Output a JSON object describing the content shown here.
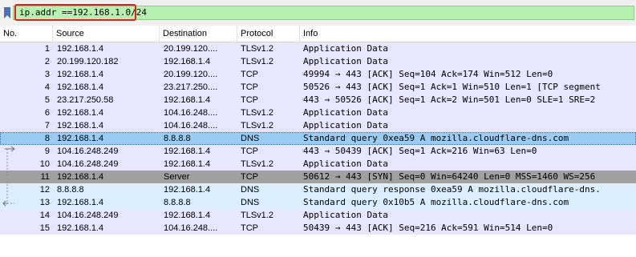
{
  "filter": {
    "text": "ip.addr ==192.168.1.0/24",
    "bookmark_icon": "bookmark-icon",
    "background": "#b7f1b1",
    "highlight_color": "#e0201b"
  },
  "columns": {
    "no": "No.",
    "source": "Source",
    "destination": "Destination",
    "protocol": "Protocol",
    "info": "Info"
  },
  "colors": {
    "tcp": "#e7e6ff",
    "udp": "#daeeff",
    "selected": "#99cbf3",
    "syn": "#a0a0a0"
  },
  "packets": [
    {
      "no": "1",
      "source": "192.168.1.4",
      "destination": "20.199.120....",
      "protocol": "TLSv1.2",
      "info": "Application Data",
      "bg": "tcp"
    },
    {
      "no": "2",
      "source": "20.199.120.182",
      "destination": "192.168.1.4",
      "protocol": "TLSv1.2",
      "info": "Application Data",
      "bg": "tcp"
    },
    {
      "no": "3",
      "source": "192.168.1.4",
      "destination": "20.199.120....",
      "protocol": "TCP",
      "info": "49994 → 443 [ACK] Seq=104 Ack=174 Win=512 Len=0",
      "bg": "tcp"
    },
    {
      "no": "4",
      "source": "192.168.1.4",
      "destination": "23.217.250....",
      "protocol": "TCP",
      "info": "50526 → 443 [ACK] Seq=1 Ack=1 Win=510 Len=1 [TCP segment",
      "bg": "tcp"
    },
    {
      "no": "5",
      "source": "23.217.250.58",
      "destination": "192.168.1.4",
      "protocol": "TCP",
      "info": "443 → 50526 [ACK] Seq=1 Ack=2 Win=501 Len=0 SLE=1 SRE=2",
      "bg": "tcp"
    },
    {
      "no": "6",
      "source": "192.168.1.4",
      "destination": "104.16.248....",
      "protocol": "TLSv1.2",
      "info": "Application Data",
      "bg": "tcp"
    },
    {
      "no": "7",
      "source": "192.168.1.4",
      "destination": "104.16.248....",
      "protocol": "TLSv1.2",
      "info": "Application Data",
      "bg": "tcp"
    },
    {
      "no": "8",
      "source": "192.168.1.4",
      "destination": "8.8.8.8",
      "protocol": "DNS",
      "info": "Standard query 0xea59 A mozilla.cloudflare-dns.com",
      "bg": "selected"
    },
    {
      "no": "9",
      "source": "104.16.248.249",
      "destination": "192.168.1.4",
      "protocol": "TCP",
      "info": "443 → 50439 [ACK] Seq=1 Ack=216 Win=63 Len=0",
      "bg": "tcp"
    },
    {
      "no": "10",
      "source": "104.16.248.249",
      "destination": "192.168.1.4",
      "protocol": "TLSv1.2",
      "info": "Application Data",
      "bg": "tcp"
    },
    {
      "no": "11",
      "source": "192.168.1.4",
      "destination": "Server",
      "protocol": "TCP",
      "info": "50612 → 443 [SYN] Seq=0 Win=64240 Len=0 MSS=1460 WS=256",
      "bg": "syn"
    },
    {
      "no": "12",
      "source": "8.8.8.8",
      "destination": "192.168.1.4",
      "protocol": "DNS",
      "info": "Standard query response 0xea59 A mozilla.cloudflare-dns.",
      "bg": "udp"
    },
    {
      "no": "13",
      "source": "192.168.1.4",
      "destination": "8.8.8.8",
      "protocol": "DNS",
      "info": "Standard query 0x10b5 A mozilla.cloudflare-dns.com",
      "bg": "udp"
    },
    {
      "no": "14",
      "source": "104.16.248.249",
      "destination": "192.168.1.4",
      "protocol": "TLSv1.2",
      "info": "Application Data",
      "bg": "tcp"
    },
    {
      "no": "15",
      "source": "192.168.1.4",
      "destination": "104.16.248....",
      "protocol": "TCP",
      "info": "50439 → 443 [ACK] Seq=216 Ack=591 Win=514 Len=0",
      "bg": "tcp"
    }
  ]
}
